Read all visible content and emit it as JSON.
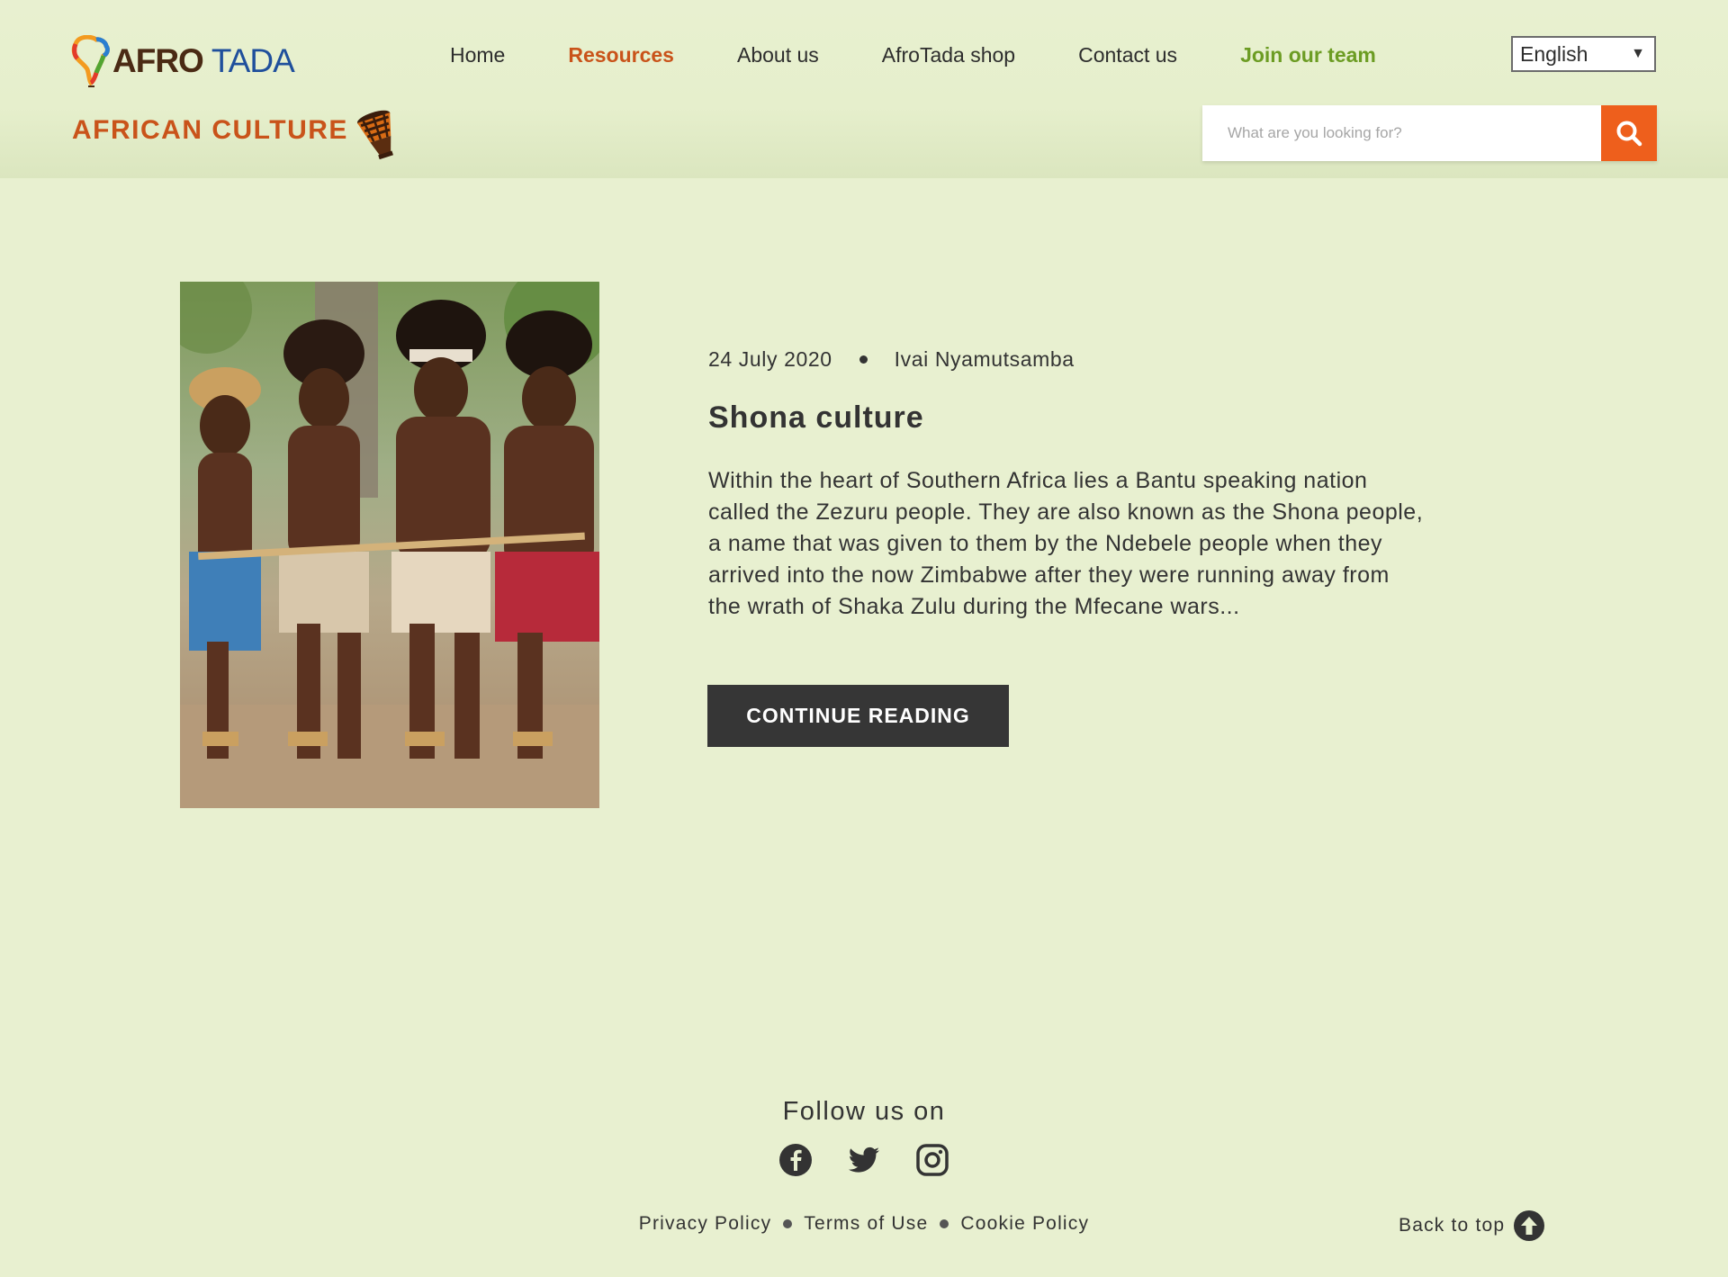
{
  "brand": {
    "logo_part1": "AFRO",
    "logo_part2": "TADA"
  },
  "nav": {
    "items": [
      {
        "label": "Home"
      },
      {
        "label": "Resources",
        "active": true
      },
      {
        "label": "About us"
      },
      {
        "label": "AfroTada shop"
      },
      {
        "label": "Contact us"
      },
      {
        "label": "Join our team"
      }
    ],
    "language": "English"
  },
  "section": {
    "title": "AFRICAN CULTURE",
    "icon": "drum-icon"
  },
  "search": {
    "placeholder": "What are you looking for?",
    "icon": "search-icon"
  },
  "article": {
    "date": "24 July 2020",
    "author": "Ivai Nyamutsamba",
    "title": "Shona culture",
    "excerpt": "Within the heart of Southern Africa lies a Bantu speaking nation called the Zezuru people. They are also known as the Shona people, a name that was given to them by the Ndebele people when they arrived into the now Zimbabwe after they were running away from the wrath of Shaka Zulu during the Mfecane wars...",
    "button": "CONTINUE READING"
  },
  "footer": {
    "follow": "Follow us on",
    "social": [
      "facebook-icon",
      "twitter-icon",
      "instagram-icon"
    ],
    "links": [
      "Privacy Policy",
      "Terms of Use",
      "Cookie Policy"
    ],
    "back_to_top": "Back to top"
  },
  "colors": {
    "background": "#e8f0d0",
    "accent_orange": "#c9531a",
    "search_button": "#ee5f1c",
    "join_green": "#6c9c23",
    "dark_button": "#363636"
  }
}
